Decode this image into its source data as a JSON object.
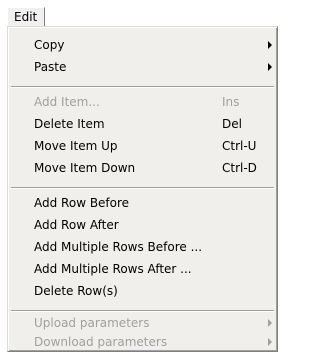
{
  "menubar": {
    "edit_label": "Edit"
  },
  "menu": {
    "copy": {
      "label": "Copy",
      "has_submenu": true,
      "enabled": true
    },
    "paste": {
      "label": "Paste",
      "has_submenu": true,
      "enabled": true
    },
    "add_item": {
      "label": "Add Item...",
      "shortcut": "Ins",
      "enabled": false
    },
    "delete_item": {
      "label": "Delete Item",
      "shortcut": "Del",
      "enabled": true
    },
    "move_item_up": {
      "label": "Move Item Up",
      "shortcut": "Ctrl-U",
      "enabled": true
    },
    "move_item_down": {
      "label": "Move Item Down",
      "shortcut": "Ctrl-D",
      "enabled": true
    },
    "add_row_before": {
      "label": "Add Row Before",
      "enabled": true
    },
    "add_row_after": {
      "label": "Add Row After",
      "enabled": true
    },
    "add_multiple_rows_before": {
      "label": "Add Multiple Rows Before ...",
      "enabled": true
    },
    "add_multiple_rows_after": {
      "label": "Add Multiple Rows After ...",
      "enabled": true
    },
    "delete_rows": {
      "label": "Delete Row(s)",
      "enabled": true
    },
    "upload_parameters": {
      "label": "Upload parameters",
      "has_submenu": true,
      "enabled": false
    },
    "download_parameters": {
      "label": "Download parameters",
      "has_submenu": true,
      "enabled": false
    }
  },
  "colors": {
    "menu_background": "#f0efec",
    "disabled_text": "#a0a0a0",
    "enabled_text": "#000000"
  }
}
